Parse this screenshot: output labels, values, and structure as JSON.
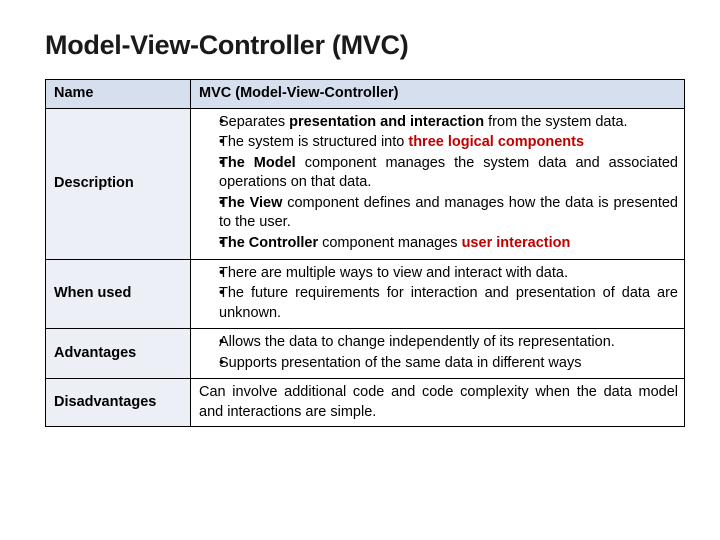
{
  "title": "Model-View-Controller (MVC)",
  "row_name_label": "Name",
  "row_name_value": "MVC (Model-View-Controller)",
  "row_desc_label": "Description",
  "desc": {
    "b1a": "Separates ",
    "b1b": "presentation and interaction",
    "b1c": " from the system data.",
    "b2a": "The system is structured into ",
    "b2b": "three logical components",
    "b3a": "The Model",
    "b3b": " component manages the system data and associated operations on that data.",
    "b4a": "The View",
    "b4b": " component defines and manages how the data is presented to the user.",
    "b5a": "The Controller",
    "b5b": " component manages ",
    "b5c": "user interaction"
  },
  "row_when_label": "When used",
  "when": {
    "b1": "There are multiple ways to view and interact with data.",
    "b2": "The future requirements for interaction and presentation of data are unknown."
  },
  "row_adv_label": "Advantages",
  "adv": {
    "b1": "Allows the data to change independently of its representation.",
    "b2": "Supports presentation of the same data in different ways"
  },
  "row_dis_label": "Disadvantages",
  "dis": "Can involve additional code and code complexity when the data model and interactions are simple."
}
